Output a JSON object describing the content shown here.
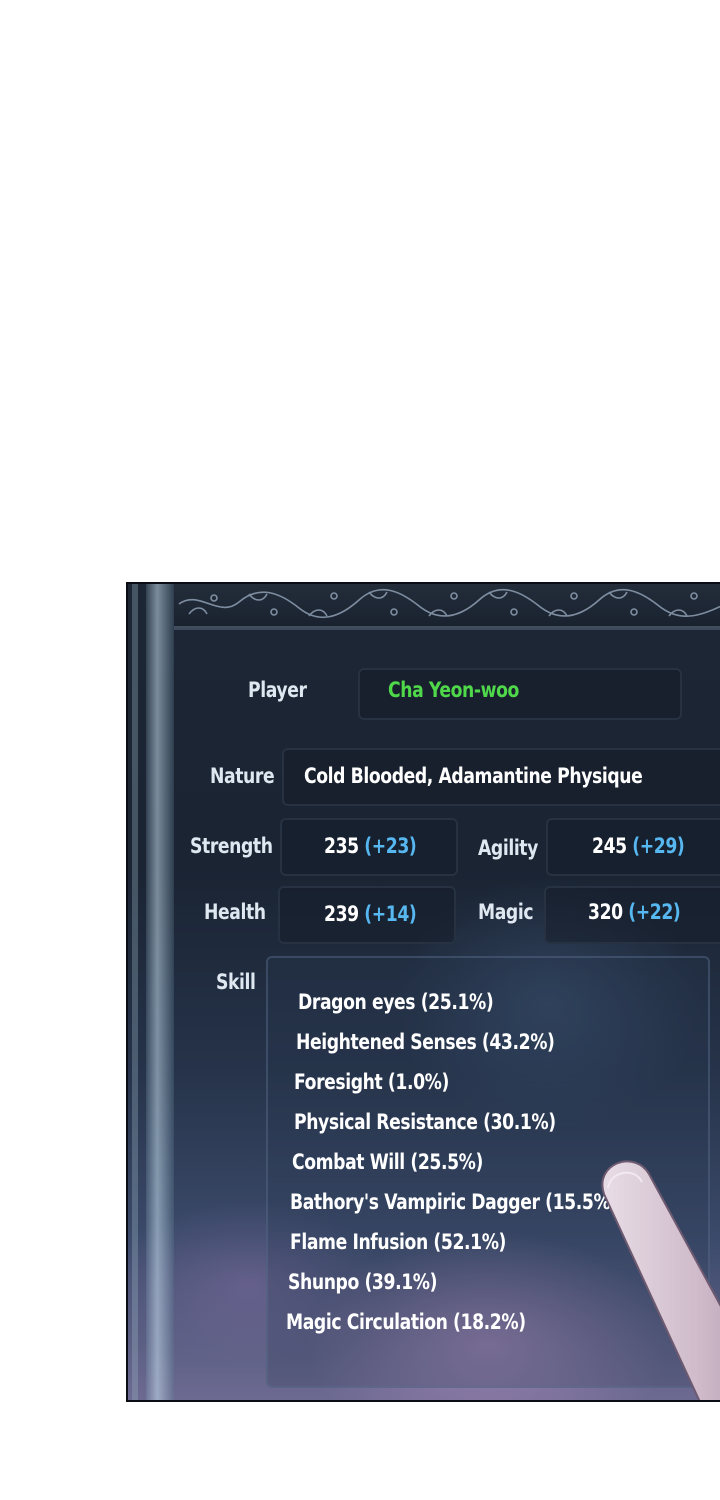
{
  "status_window": {
    "player": {
      "label": "Player",
      "value": "Cha Yeon-woo"
    },
    "nature": {
      "label": "Nature",
      "value": "Cold Blooded, Adamantine Physique"
    },
    "strength": {
      "label": "Strength",
      "base": "235",
      "bonus": "(+23)"
    },
    "agility": {
      "label": "Agility",
      "base": "245",
      "bonus": "(+29)"
    },
    "health": {
      "label": "Health",
      "base": "239",
      "bonus": "(+14)"
    },
    "magic": {
      "label": "Magic",
      "base": "320",
      "bonus": "(+22)"
    },
    "skill": {
      "label": "Skill",
      "items": [
        "Dragon eyes (25.1%)",
        "Heightened Senses (43.2%)",
        "Foresight (1.0%)",
        "Physical Resistance (30.1%)",
        "Combat Will (25.5%)",
        "Bathory's Vampiric Dagger (15.5%",
        "Flame Infusion (52.1%)",
        "Shunpo (39.1%)",
        "Magic Circulation (18.2%)"
      ]
    }
  },
  "colors": {
    "name_green": "#4fd84a",
    "bonus_blue": "#57b7f0",
    "panel_dark": "#1c2634"
  }
}
